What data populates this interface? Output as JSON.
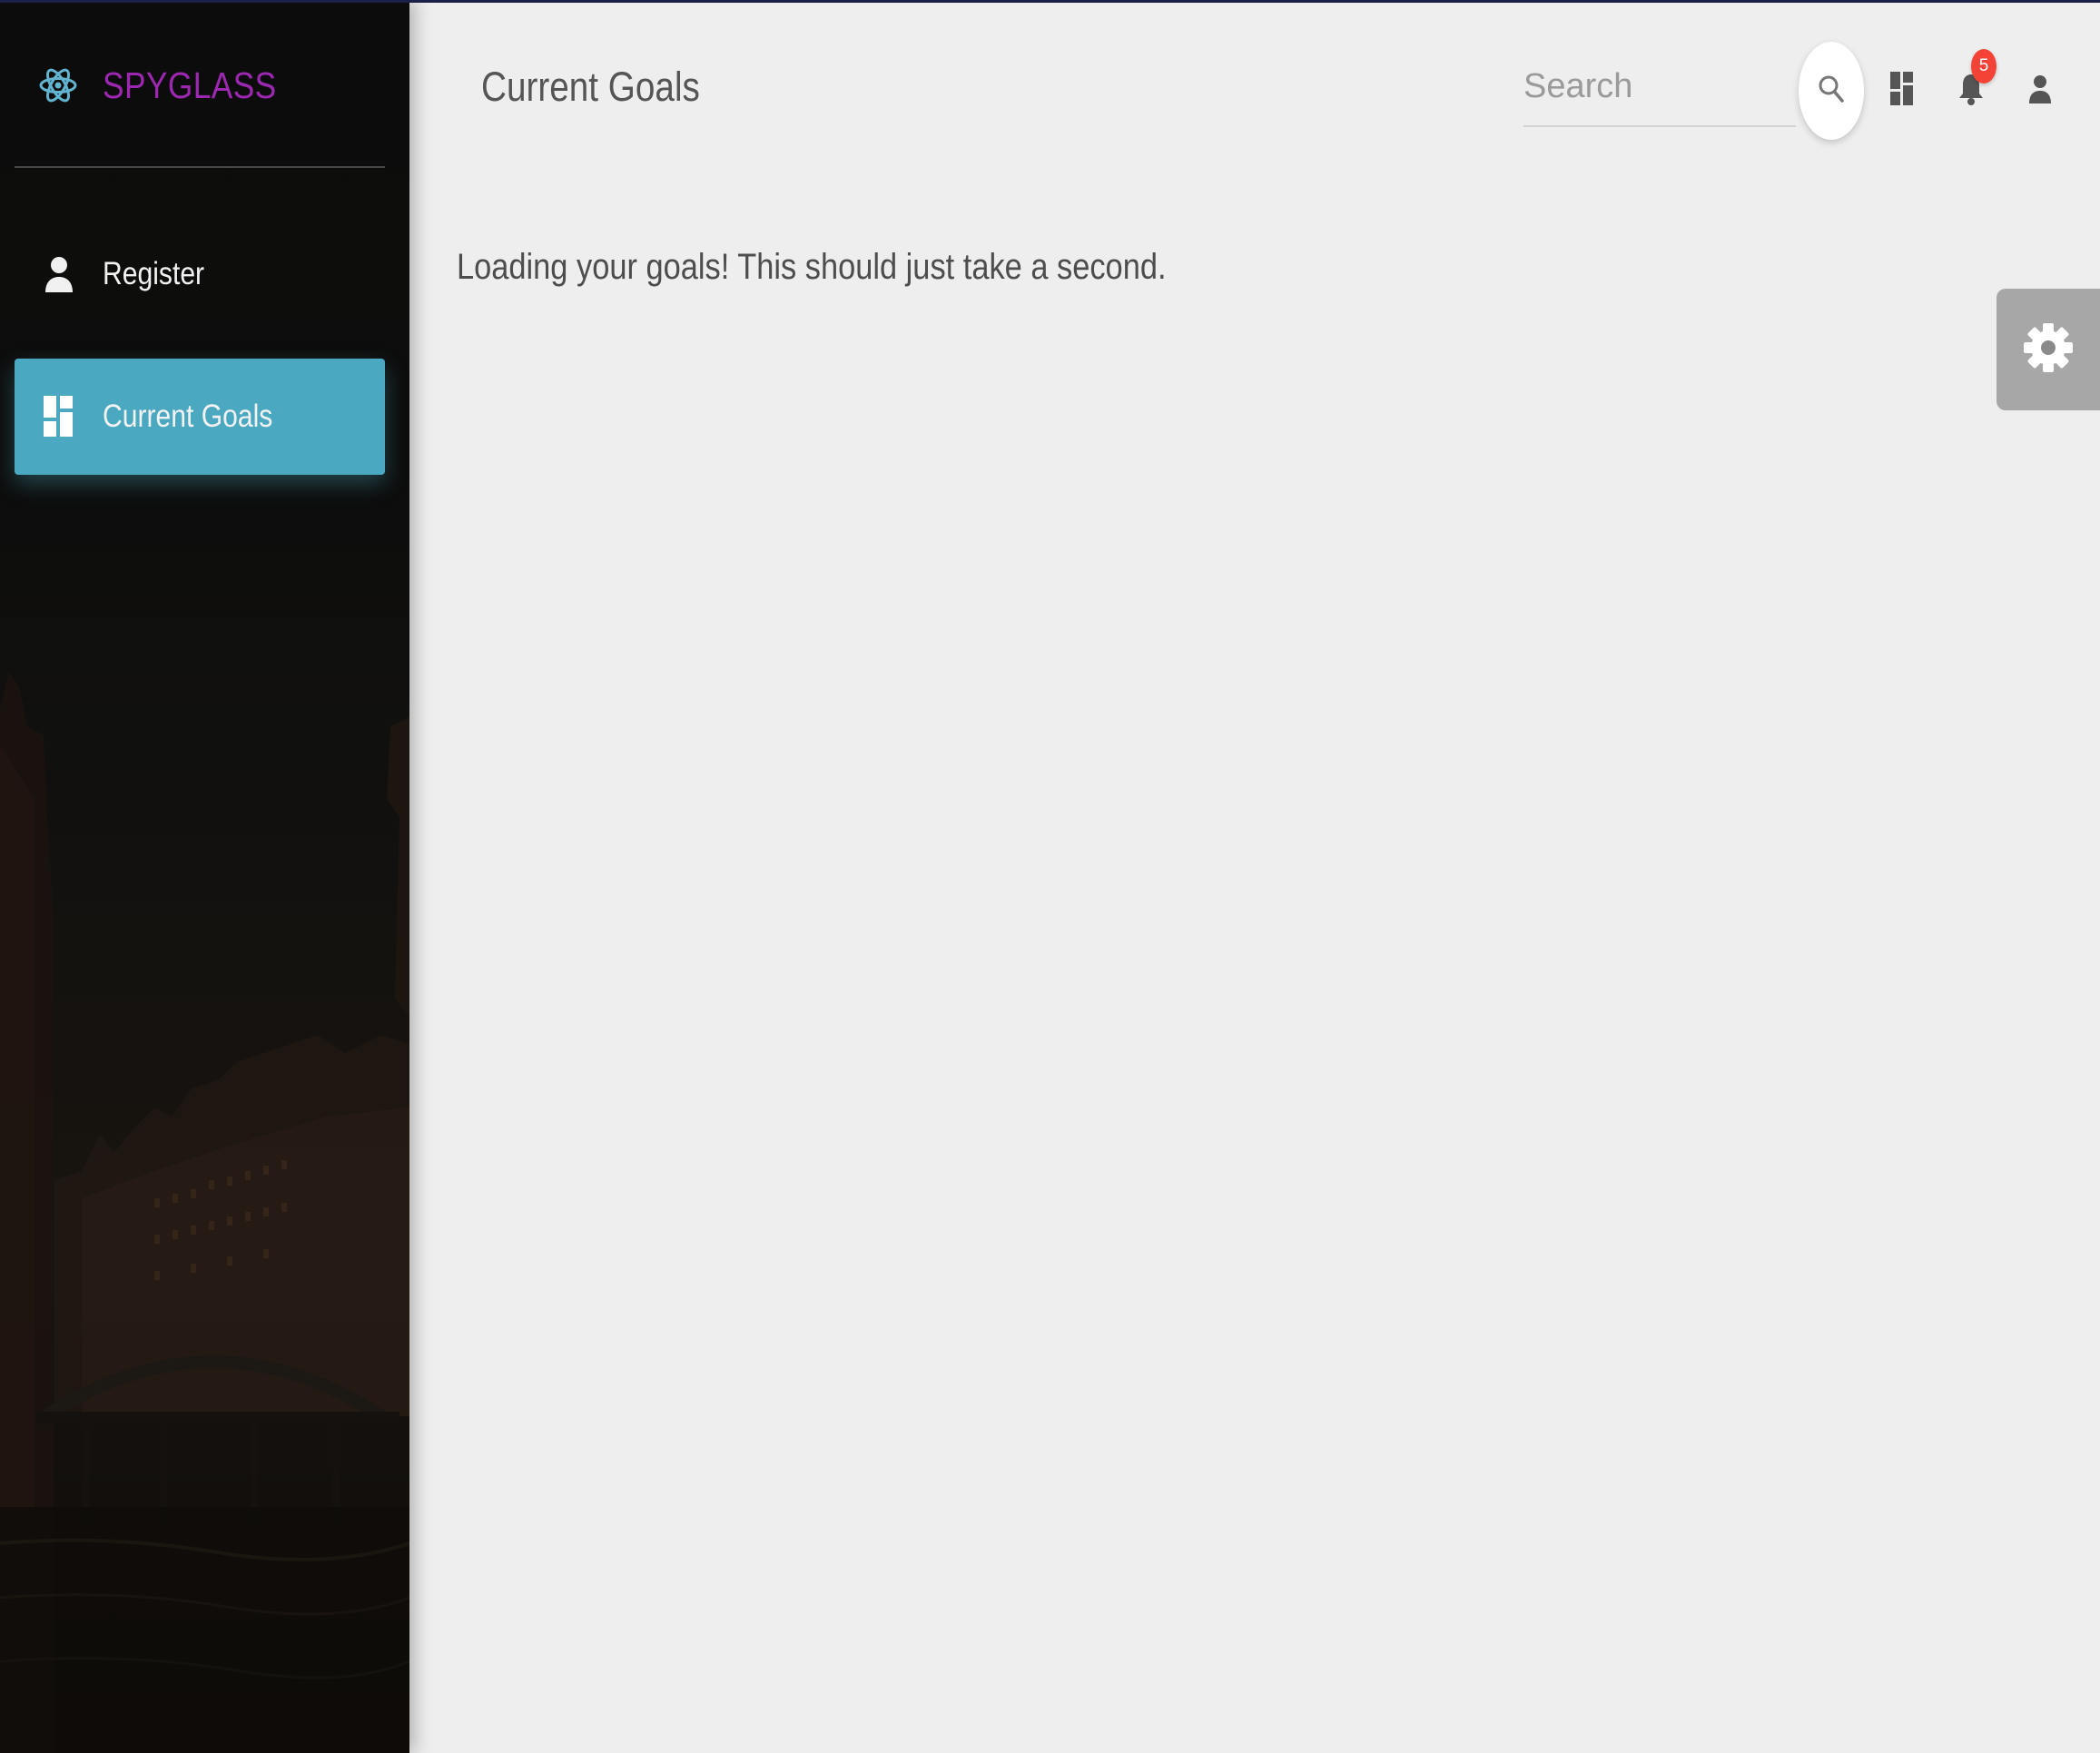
{
  "brand": {
    "name": "SPYGLASS",
    "logo_icon": "atom-icon",
    "color": "#9c27b0"
  },
  "sidebar": {
    "items": [
      {
        "label": "Register",
        "icon": "person-icon",
        "active": false
      },
      {
        "label": "Current Goals",
        "icon": "dashboard-icon",
        "active": true
      }
    ],
    "active_color": "#4aa8c0"
  },
  "header": {
    "title": "Current Goals",
    "search": {
      "placeholder": "Search",
      "value": ""
    },
    "notifications": {
      "count": "5",
      "badge_color": "#f44336"
    }
  },
  "main": {
    "message": "Loading your goals! This should just take a second."
  },
  "settings": {
    "icon": "gear-icon"
  }
}
